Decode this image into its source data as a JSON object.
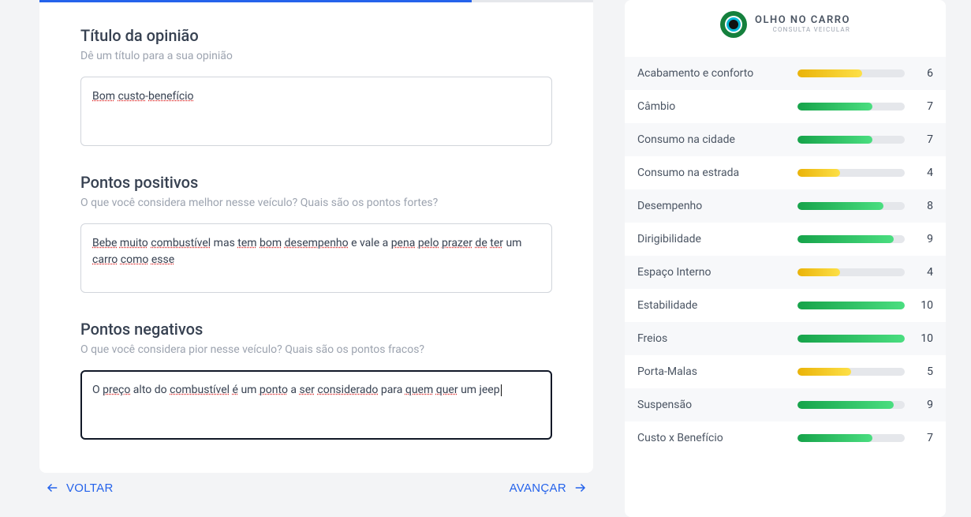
{
  "form": {
    "sections": {
      "title": {
        "heading": "Título da opinião",
        "sub": "Dê um título para a sua opinião",
        "value": "Bom custo-benefício"
      },
      "positives": {
        "heading": "Pontos positivos",
        "sub": "O que você considera melhor nesse veículo? Quais são os pontos fortes?",
        "value": "Bebe muito combustível mas tem bom desempenho e vale a pena pelo prazer de ter um carro como esse"
      },
      "negatives": {
        "heading": "Pontos negativos",
        "sub": "O que você considera pior nesse veículo? Quais são os pontos fracos?",
        "value": "O preço alto do combustível é um ponto a ser considerado para quem quer um jeep"
      }
    },
    "actions": {
      "back": "VOLTAR",
      "next": "AVANÇAR"
    },
    "progress_pct": 78
  },
  "brand": {
    "line1": "OLHO NO CARRO",
    "line2": "CONSULTA VEICULAR"
  },
  "metrics": [
    {
      "label": "Acabamento e conforto",
      "value": 6,
      "color": "yellow"
    },
    {
      "label": "Câmbio",
      "value": 7,
      "color": "green"
    },
    {
      "label": "Consumo na cidade",
      "value": 7,
      "color": "green"
    },
    {
      "label": "Consumo na estrada",
      "value": 4,
      "color": "yellow"
    },
    {
      "label": "Desempenho",
      "value": 8,
      "color": "green"
    },
    {
      "label": "Dirigibilidade",
      "value": 9,
      "color": "green"
    },
    {
      "label": "Espaço Interno",
      "value": 4,
      "color": "yellow"
    },
    {
      "label": "Estabilidade",
      "value": 10,
      "color": "green"
    },
    {
      "label": "Freios",
      "value": 10,
      "color": "green"
    },
    {
      "label": "Porta-Malas",
      "value": 5,
      "color": "yellow"
    },
    {
      "label": "Suspensão",
      "value": 9,
      "color": "green"
    },
    {
      "label": "Custo x Benefício",
      "value": 7,
      "color": "green"
    }
  ],
  "spellcheck_words": [
    "Bom",
    "custo",
    "benefício",
    "Bebe",
    "muito",
    "combustível",
    "tem",
    "bom",
    "desempenho",
    "pena",
    "pelo",
    "prazer",
    "de",
    "ter",
    "carro",
    "como",
    "esse",
    "preço",
    "ponto",
    "ser",
    "considerado",
    "quem",
    "quer",
    "é"
  ]
}
